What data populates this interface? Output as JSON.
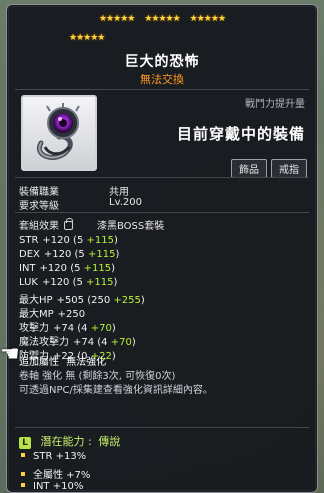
{
  "stars": {
    "row1": [
      "★★★★★",
      "★★★★★",
      "★★★★★"
    ],
    "row2": [
      "★★★★★"
    ]
  },
  "item": {
    "name": "巨大的恐怖",
    "trade_note": "無法交換"
  },
  "header": {
    "power_label": "戰鬥力提升量",
    "current_equip": "目前穿戴中的裝備",
    "tags": [
      "飾品",
      "戒指"
    ]
  },
  "info": {
    "job_label": "裝備職業",
    "job_value": "共用",
    "level_label": "要求等級",
    "level_value": "Lv.200",
    "set_label": "套組效果",
    "set_value": "漆黑BOSS套裝"
  },
  "stats": [
    {
      "name": "STR",
      "text": "+120 (5 ",
      "bonus": "+115",
      "end": ")"
    },
    {
      "name": "DEX",
      "text": "+120 (5 ",
      "bonus": "+115",
      "end": ")"
    },
    {
      "name": "INT",
      "text": "+120 (5 ",
      "bonus": "+115",
      "end": ")"
    },
    {
      "name": "LUK",
      "text": "+120 (5 ",
      "bonus": "+115",
      "end": ")"
    },
    {
      "name": "最大HP",
      "text": "+505 (250 ",
      "bonus": "+255",
      "end": ")"
    },
    {
      "name": "最大MP",
      "text": "+250",
      "bonus": "",
      "end": ""
    },
    {
      "name": "攻擊力",
      "text": "+74 (4 ",
      "bonus": "+70",
      "end": ")"
    },
    {
      "name": "魔法攻擊力",
      "text": "+74 (4 ",
      "bonus": "+70",
      "end": ")"
    },
    {
      "name": "防禦力",
      "text": "+22 (0 ",
      "bonus": "+22",
      "end": ")"
    }
  ],
  "extra": {
    "attr_label": "追加屬性",
    "attr_value": "無法強化",
    "scroll_line": "卷軸 強化 無 (剩餘3次, 可恢復0次)",
    "note_line": "可透過NPC/採集建查看強化資訊詳細內容。"
  },
  "potential": {
    "badge": "L",
    "label": "潛在能力 :",
    "grade": "傳說",
    "lines": [
      "STR +13%",
      "全屬性 +7%",
      "INT +10%"
    ]
  }
}
